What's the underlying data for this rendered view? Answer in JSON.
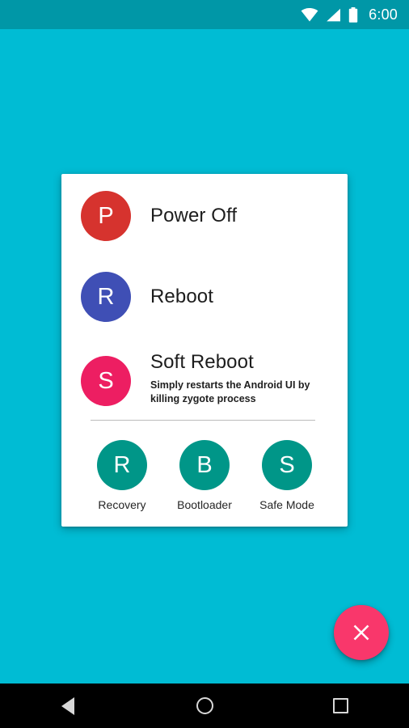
{
  "theme": {
    "background": "#00bcd4",
    "status_bar": "#0097a7",
    "card": "#ffffff",
    "accent_pink": "#f9376b",
    "divider": "#bcbcbc",
    "nav_bar": "#000000"
  },
  "status_bar": {
    "time": "6:00",
    "icons": [
      "wifi-icon",
      "signal-icon",
      "battery-icon"
    ]
  },
  "dialog": {
    "actions": [
      {
        "initial": "P",
        "title": "Power Off",
        "subtitle": "",
        "color": "#d6332e",
        "name": "power-off"
      },
      {
        "initial": "R",
        "title": "Reboot",
        "subtitle": "",
        "color": "#3f4fb5",
        "name": "reboot"
      },
      {
        "initial": "S",
        "title": "Soft Reboot",
        "subtitle": "Simply restarts the Android UI by killing zygote process",
        "color": "#ed1e62",
        "name": "soft-reboot"
      }
    ],
    "quick_actions": [
      {
        "initial": "R",
        "label": "Recovery",
        "color": "#009688",
        "name": "recovery"
      },
      {
        "initial": "B",
        "label": "Bootloader",
        "color": "#009688",
        "name": "bootloader"
      },
      {
        "initial": "S",
        "label": "Safe Mode",
        "color": "#009688",
        "name": "safe-mode"
      }
    ]
  },
  "fab": {
    "icon": "close-icon",
    "color": "#f9376b",
    "label": ""
  },
  "nav_bar": {
    "buttons": [
      {
        "icon": "back-icon",
        "label": "Back"
      },
      {
        "icon": "home-icon",
        "label": "Home"
      },
      {
        "icon": "recents-icon",
        "label": "Recents"
      }
    ]
  }
}
